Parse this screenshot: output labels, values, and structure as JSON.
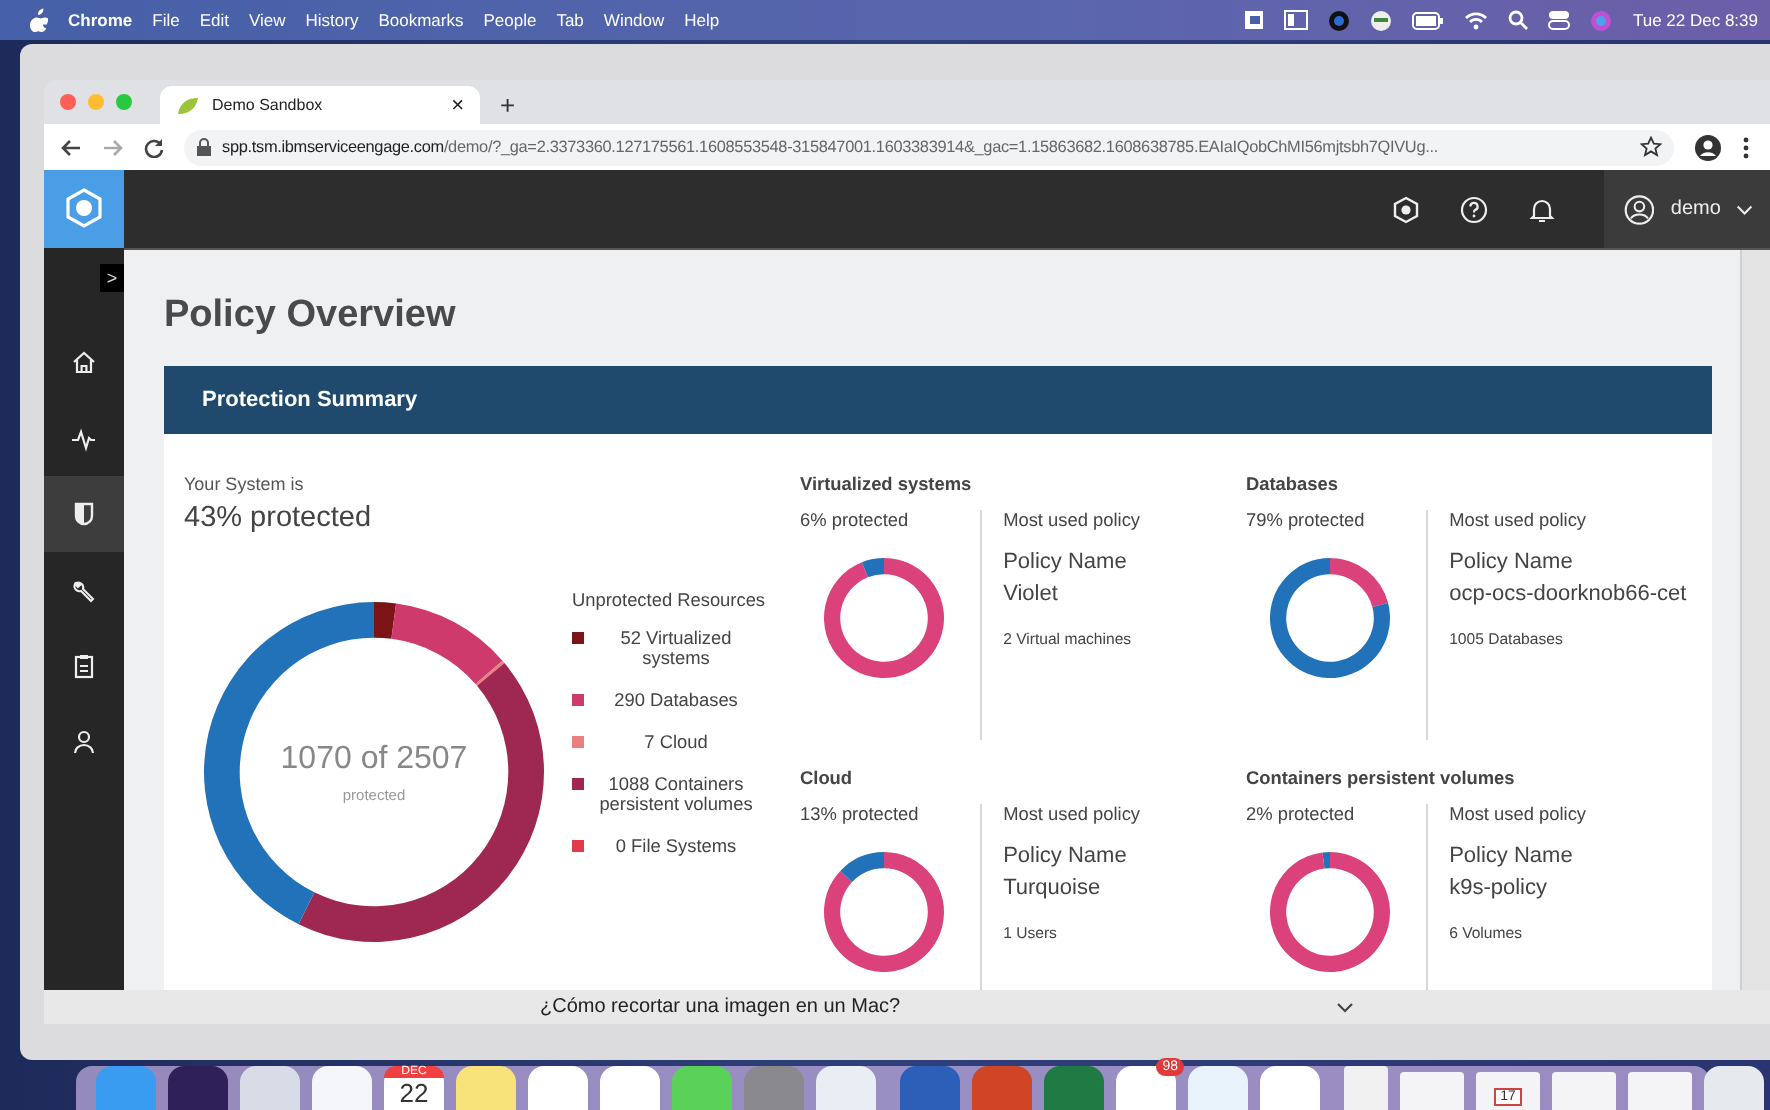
{
  "menu_bar": {
    "app": "Chrome",
    "menus": [
      "File",
      "Edit",
      "View",
      "History",
      "Bookmarks",
      "People",
      "Tab",
      "Window",
      "Help"
    ],
    "clock": "Tue 22 Dec 8:39"
  },
  "browser": {
    "tabs": [
      {
        "title": "Demo Sandbox",
        "close": "×",
        "selected": true
      }
    ],
    "new_tab": "+",
    "url_host": "spp.tsm.ibmserviceengage.com",
    "url_path": "/demo/?_ga=2.3373360.127175561.1608553548-315847001.1603383914&_gac=1.15863682.1608638785.EAIaIQobChMI56mjtsbh7QIVUg..."
  },
  "sidebar": {
    "expand": ">",
    "items": [
      {
        "selected": false
      },
      {
        "selected": false
      },
      {
        "selected": true
      },
      {
        "selected": false
      },
      {
        "selected": false
      },
      {
        "selected": false
      }
    ]
  },
  "header": {
    "user": "demo"
  },
  "page_title": "Policy Overview",
  "panel": {
    "title": "Protection Summary",
    "system_label": "Your System is",
    "system_value": "43% protected",
    "center_value": "1070 of 2507",
    "center_caption": "protected",
    "legend_title": "Unprotected Resources",
    "legend": [
      "52 Virtualized systems",
      "290 Databases",
      "7 Cloud",
      "1088 Containers persistent volumes",
      "0 File Systems"
    ],
    "chart_data": {
      "type": "donut",
      "values": [
        2.07,
        11.57,
        0.28,
        43.4,
        0,
        42.68
      ],
      "colors": [
        "#7a1416",
        "#cf3a6c",
        "#e8807e",
        "#9e2852",
        "#e23a48",
        "#2272b9"
      ]
    },
    "categories": [
      {
        "title": "Virtualized systems",
        "protected": "6% protected",
        "chart_data": {
          "type": "donut",
          "values": [
            94,
            6
          ],
          "colors": [
            "#db417b",
            "#2272b9"
          ]
        },
        "policy_label": "Most used policy",
        "policy_name_label": "Policy Name",
        "policy_name": "Violet",
        "count": "2 Virtual machines"
      },
      {
        "title": "Databases",
        "protected": "79% protected",
        "chart_data": {
          "type": "donut",
          "values": [
            21,
            79
          ],
          "colors": [
            "#db417b",
            "#2272b9"
          ]
        },
        "policy_label": "Most used policy",
        "policy_name_label": "Policy Name",
        "policy_name": "ocp-ocs-doorknob66-cet",
        "count": "1005 Databases"
      },
      {
        "title": "Cloud",
        "protected": "13% protected",
        "chart_data": {
          "type": "donut",
          "values": [
            87,
            13
          ],
          "colors": [
            "#db417b",
            "#2272b9"
          ]
        },
        "policy_label": "Most used policy",
        "policy_name_label": "Policy Name",
        "policy_name": "Turquoise",
        "count": "1 Users"
      },
      {
        "title": "Containers persistent volumes",
        "protected": "2% protected",
        "chart_data": {
          "type": "donut",
          "values": [
            98,
            2
          ],
          "colors": [
            "#db417b",
            "#2272b9"
          ]
        },
        "policy_label": "Most used policy",
        "policy_name_label": "Policy Name",
        "policy_name": "k9s-policy",
        "count": "6 Volumes"
      }
    ]
  },
  "back_window": {
    "title": "¿Cómo recortar una imagen en un Mac?"
  },
  "dock": {
    "calendar_month": "DEC",
    "calendar_day": "22",
    "badge": "98",
    "thumbnail_day": "17"
  }
}
